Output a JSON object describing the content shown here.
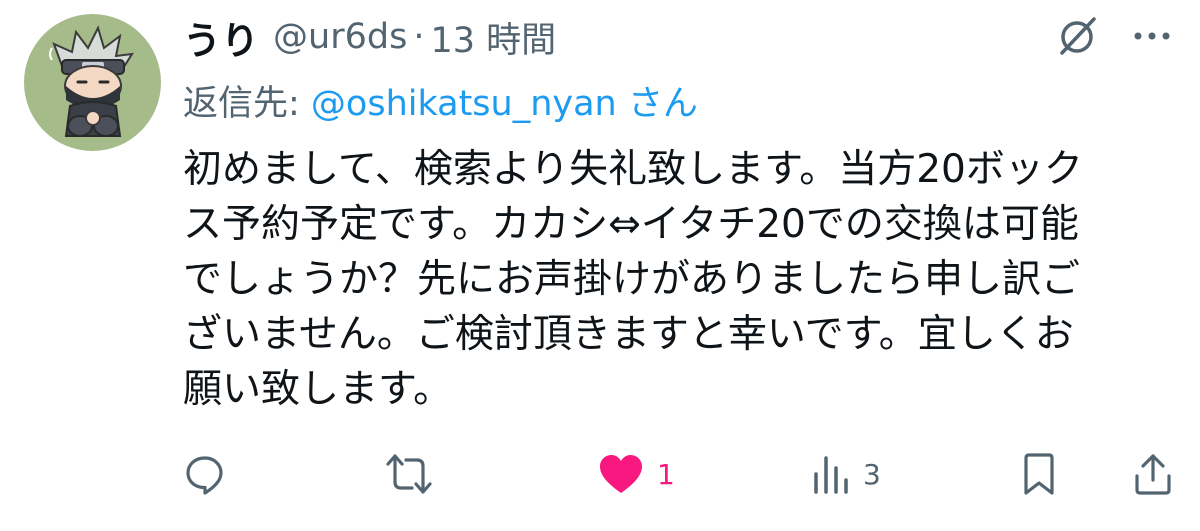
{
  "tweet": {
    "display_name": "うり",
    "handle": "@ur6ds",
    "separator": "·",
    "time": "13 時間",
    "reply_prefix": "返信先: ",
    "reply_handle": "@oshikatsu_nyan",
    "reply_suffix": " さん",
    "text": "初めまして、検索より失礼致します。当方20ボック\nス予約予定です。カカシ⇔イタチ20での交換は可能\nでしょうか？先にお声掛けがありましたら申し訳ご\nざいません。ご検討頂きますと幸いです。宜しくお\n願い致します。"
  },
  "header_icons": [
    "grok-icon",
    "more-icon"
  ],
  "actions": {
    "reply": {
      "icon": "reply-icon"
    },
    "retweet": {
      "icon": "retweet-icon"
    },
    "like": {
      "icon": "heart-icon",
      "count": "1",
      "liked": true
    },
    "views": {
      "icon": "views-icon",
      "count": "3"
    },
    "bookmark": {
      "icon": "bookmark-icon"
    },
    "share": {
      "icon": "share-icon"
    }
  },
  "colors": {
    "text": "#0f1419",
    "secondary": "#536471",
    "link": "#1d9bf0",
    "like": "#f91880",
    "avatar_bg": "#a6bb8a"
  }
}
